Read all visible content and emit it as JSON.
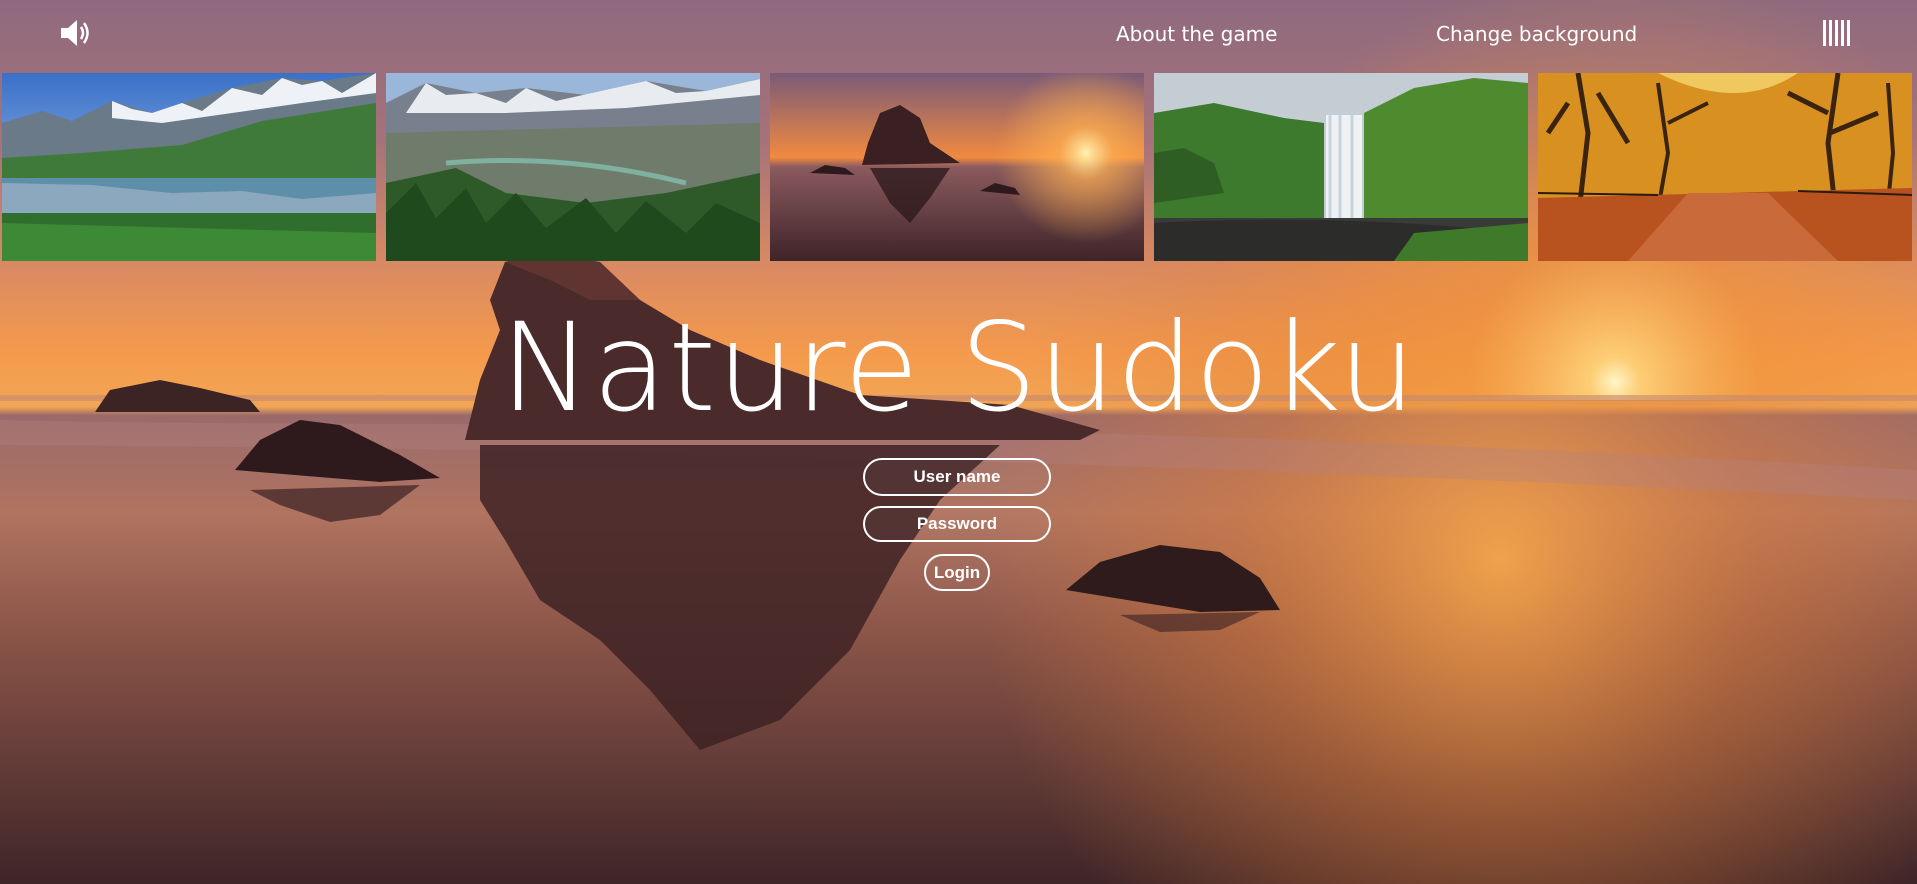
{
  "app": {
    "title": "Nature Sudoku"
  },
  "nav": {
    "about_label": "About the game",
    "change_bg_label": "Change background",
    "sound_icon": "speaker-volume-icon",
    "menu_icon": "vertical-bars-menu-icon"
  },
  "thumbnails": [
    {
      "scene": "mountain-lake"
    },
    {
      "scene": "mountain-valley"
    },
    {
      "scene": "sunset-sea-rock"
    },
    {
      "scene": "waterfall"
    },
    {
      "scene": "autumn-trees-path"
    }
  ],
  "login": {
    "username_placeholder": "User name",
    "password_placeholder": "Password",
    "login_label": "Login"
  },
  "colors": {
    "sky_top": "#9c7080",
    "sky_horizon": "#f4954a",
    "sun": "#fff3b0",
    "water_dark": "#3a2226"
  }
}
